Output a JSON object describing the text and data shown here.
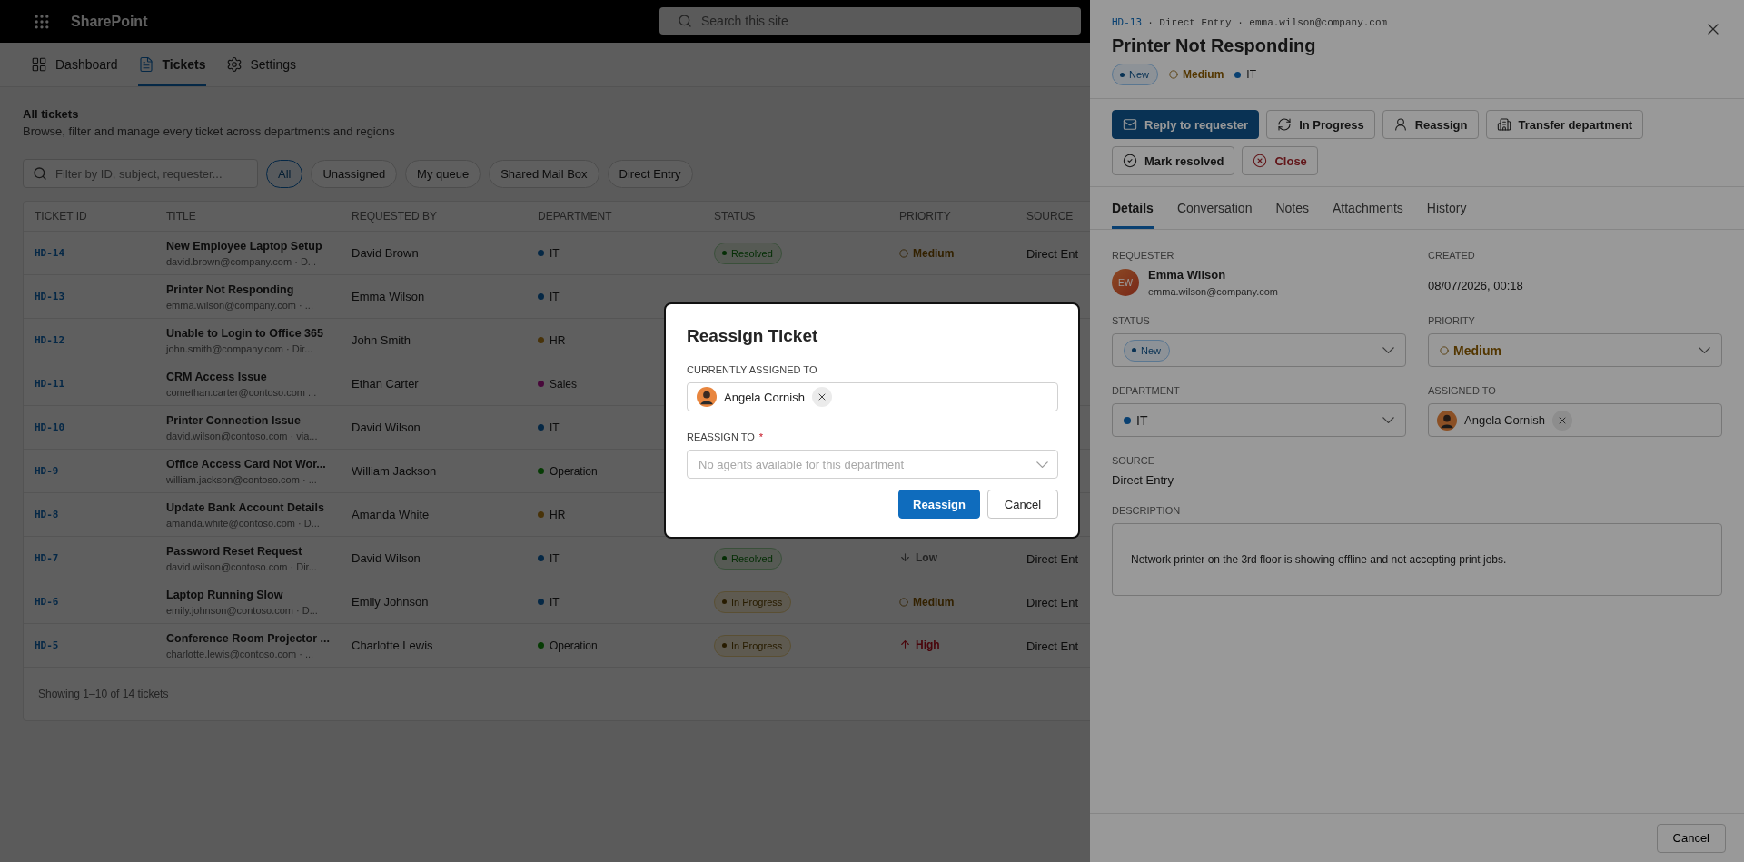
{
  "top_bar": {
    "app_name": "SharePoint",
    "search": {
      "placeholder": "Search this site"
    }
  },
  "nav": [
    {
      "label": "Dashboard",
      "selected": false
    },
    {
      "label": "Tickets",
      "selected": true
    },
    {
      "label": "Settings",
      "selected": false
    }
  ],
  "page": {
    "title": "All tickets",
    "subtitle": "Browse, filter and manage every ticket across departments and regions"
  },
  "filter": {
    "placeholder": "Filter by ID, subject, requester...",
    "chips": [
      {
        "label": "All",
        "selected": true
      },
      {
        "label": "Unassigned",
        "selected": false
      },
      {
        "label": "My queue",
        "selected": false
      },
      {
        "label": "Shared Mail Box",
        "selected": false
      },
      {
        "label": "Direct Entry",
        "selected": false
      }
    ]
  },
  "table": {
    "columns": [
      "TICKET ID",
      "TITLE",
      "REQUESTED BY",
      "DEPARTMENT",
      "STATUS",
      "PRIORITY",
      "SOURCE"
    ],
    "rows": [
      {
        "id": "HD-14",
        "title": "New Employee Laptop Setup",
        "subtitle": "david.brown@company.com · D...",
        "requested_by": "David Brown",
        "department": {
          "name": "IT",
          "color": "#062846"
        },
        "status": {
          "label": "Resolved",
          "kind": "resolved"
        },
        "priority": {
          "label": "Medium",
          "kind": "medium"
        },
        "source": "Direct Ent"
      },
      {
        "id": "HD-13",
        "title": "Printer Not Responding",
        "subtitle": "emma.wilson@company.com · ...",
        "requested_by": "Emma Wilson",
        "department": {
          "name": "IT",
          "color": "#062846"
        }
      },
      {
        "id": "HD-12",
        "title": "Unable to Login to Office 365",
        "subtitle": "john.smith@company.com · Dir...",
        "requested_by": "John Smith",
        "department": {
          "name": "HR",
          "color": "#49330a"
        }
      },
      {
        "id": "HD-11",
        "title": "CRM Access Issue",
        "subtitle": "comethan.carter@contoso.com ...",
        "requested_by": "Ethan Carter",
        "department": {
          "name": "Sales",
          "color": "#48093b"
        }
      },
      {
        "id": "HD-10",
        "title": "Printer Connection Issue",
        "subtitle": "david.wilson@contoso.com · via...",
        "requested_by": "David Wilson",
        "department": {
          "name": "IT",
          "color": "#062846"
        }
      },
      {
        "id": "HD-9",
        "title": "Office Access Card Not Wor...",
        "subtitle": "william.jackson@contoso.com · ...",
        "requested_by": "William Jackson",
        "department": {
          "name": "Operation",
          "color": "#073c05"
        }
      },
      {
        "id": "HD-8",
        "title": "Update Bank Account Details",
        "subtitle": "amanda.white@contoso.com · D...",
        "requested_by": "Amanda White",
        "department": {
          "name": "HR",
          "color": "#49330a"
        }
      },
      {
        "id": "HD-7",
        "title": "Password Reset Request",
        "subtitle": "david.wilson@contoso.com · Dir...",
        "requested_by": "David Wilson",
        "department": {
          "name": "IT",
          "color": "#062846"
        },
        "status": {
          "label": "Resolved",
          "kind": "resolved"
        },
        "priority": {
          "label": "Low",
          "kind": "low"
        },
        "source": "Direct Ent"
      },
      {
        "id": "HD-6",
        "title": "Laptop Running Slow",
        "subtitle": "emily.johnson@contoso.com · D...",
        "requested_by": "Emily Johnson",
        "department": {
          "name": "IT",
          "color": "#062846"
        },
        "status": {
          "label": "In Progress",
          "kind": "in_progress"
        },
        "priority": {
          "label": "Medium",
          "kind": "medium"
        },
        "source": "Direct Ent"
      },
      {
        "id": "HD-5",
        "title": "Conference Room Projector ...",
        "subtitle": "charlotte.lewis@contoso.com · ...",
        "requested_by": "Charlotte Lewis",
        "department": {
          "name": "Operation",
          "color": "#073c05"
        },
        "status": {
          "label": "In Progress",
          "kind": "in_progress"
        },
        "priority": {
          "label": "High",
          "kind": "high"
        },
        "source": "Direct Ent"
      }
    ],
    "footer": "Showing 1–10 of 14 tickets"
  },
  "panel": {
    "ticket_id": "HD-13",
    "meta": "· Direct Entry · emma.wilson@company.com",
    "title": "Printer Not Responding",
    "status": {
      "label": "New",
      "kind": "new"
    },
    "priority": {
      "label": "Medium",
      "kind": "medium"
    },
    "department": {
      "name": "IT",
      "color": "#094171"
    },
    "actions": [
      {
        "label": "Reply to requester",
        "kind": "primary"
      },
      {
        "label": "In Progress",
        "kind": "default"
      },
      {
        "label": "Reassign",
        "kind": "default"
      },
      {
        "label": "Transfer department",
        "kind": "default"
      },
      {
        "label": "Mark resolved",
        "kind": "default"
      },
      {
        "label": "Close",
        "kind": "danger"
      }
    ],
    "tabs": [
      {
        "label": "Details",
        "selected": true
      },
      {
        "label": "Conversation",
        "selected": false
      },
      {
        "label": "Notes",
        "selected": false
      },
      {
        "label": "Attachments",
        "selected": false
      },
      {
        "label": "History",
        "selected": false
      }
    ],
    "requester": {
      "label": "REQUESTER",
      "initials": "EW",
      "name": "Emma Wilson",
      "email": "emma.wilson@company.com"
    },
    "created": {
      "label": "CREATED",
      "value": "08/07/2026, 00:18"
    },
    "status_field": {
      "label": "STATUS",
      "value": {
        "label": "New",
        "kind": "new"
      }
    },
    "priority_field": {
      "label": "PRIORITY",
      "value": {
        "label": "Medium",
        "kind": "medium"
      }
    },
    "department_field": {
      "label": "DEPARTMENT",
      "value": {
        "name": "IT",
        "color": "#094171"
      }
    },
    "assigned_field": {
      "label": "ASSIGNED TO",
      "name": "Angela Cornish"
    },
    "source": {
      "label": "SOURCE",
      "value": "Direct Entry"
    },
    "description": {
      "label": "DESCRIPTION",
      "value": "Network printer on the 3rd floor is showing offline and not accepting print jobs."
    },
    "footer_button": "Cancel"
  },
  "dialog": {
    "title": "Reassign Ticket",
    "current_label": "CURRENTLY ASSIGNED TO",
    "current_name": "Angela Cornish",
    "reassign_label": "REASSIGN TO",
    "required_mark": "*",
    "select_placeholder": "No agents available for this department",
    "buttons": [
      {
        "label": "Reassign",
        "kind": "primary"
      },
      {
        "label": "Cancel",
        "kind": "default"
      }
    ]
  }
}
